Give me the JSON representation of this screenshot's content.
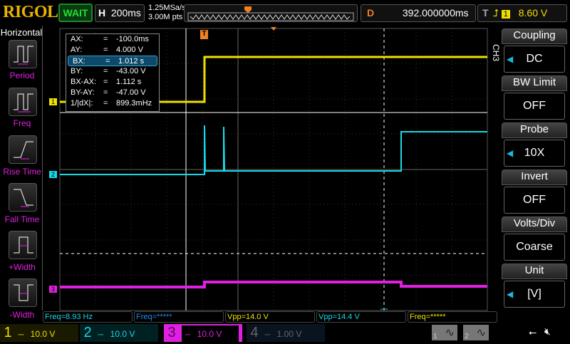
{
  "header": {
    "logo": "RIGOL",
    "status": "WAIT",
    "h_label": "H",
    "timebase": "200ms",
    "sample_rate": "1.25MSa/s",
    "memory_depth": "3.00M pts",
    "d_label": "D",
    "delay": "392.000000ms",
    "t_label": "T",
    "trigger_source": "1",
    "trigger_level": "8.60 V"
  },
  "sidebar": {
    "title": "Horizontal",
    "items": [
      {
        "label": "Period",
        "icon": "period-icon"
      },
      {
        "label": "Freq",
        "icon": "freq-icon"
      },
      {
        "label": "Rise Time",
        "icon": "rise-time-icon"
      },
      {
        "label": "Fall Time",
        "icon": "fall-time-icon"
      },
      {
        "label": "+Width",
        "icon": "positive-width-icon"
      },
      {
        "label": "-Width",
        "icon": "negative-width-icon"
      }
    ]
  },
  "cursor": {
    "rows": [
      {
        "k": "AX:",
        "v": "-100.0ms"
      },
      {
        "k": "AY:",
        "v": "4.000 V"
      },
      {
        "k": "BX:",
        "v": "1.012 s"
      },
      {
        "k": "BY:",
        "v": "-43.00 V"
      },
      {
        "k": "BX-AX:",
        "v": "1.112 s"
      },
      {
        "k": "BY-AY:",
        "v": "-47.00 V"
      },
      {
        "k": "1/|dX|:",
        "v": "899.3mHz"
      }
    ]
  },
  "menu": {
    "channel": "CH3",
    "items": [
      {
        "title": "Coupling",
        "value": "DC"
      },
      {
        "title": "BW Limit",
        "value": "OFF"
      },
      {
        "title": "Probe",
        "value": "10X"
      },
      {
        "title": "Invert",
        "value": "OFF"
      },
      {
        "title": "Volts/Div",
        "value": "Coarse"
      },
      {
        "title": "Unit",
        "value": "[V]"
      }
    ]
  },
  "measurements": [
    {
      "text": "Freq=8.93 Hz",
      "color": "#19d8e8"
    },
    {
      "text": "Freq=*****",
      "color": "#1e8cf0"
    },
    {
      "text": "Vpp=14.0 V",
      "color": "#f0e000"
    },
    {
      "text": "Vpp=14.4 V",
      "color": "#19d8e8"
    },
    {
      "text": "Freq=*****",
      "color": "#f0e000"
    }
  ],
  "channels": [
    {
      "num": "1",
      "scale": "10.0 V",
      "color": "#f0e000"
    },
    {
      "num": "2",
      "scale": "10.0 V",
      "color": "#19d8e8"
    },
    {
      "num": "3",
      "scale": "10.0 V",
      "color": "#e020e0"
    },
    {
      "num": "4",
      "scale": "1.00 V",
      "color": "#555"
    }
  ],
  "markers": {
    "ch1": "1",
    "ch2": "2",
    "ch3": "3",
    "trigger": "T"
  },
  "math": [
    "1",
    "2"
  ]
}
